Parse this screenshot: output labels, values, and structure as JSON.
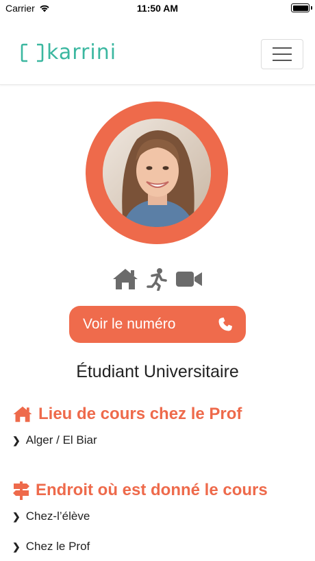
{
  "status_bar": {
    "carrier": "Carrier",
    "time": "11:50 AM",
    "wifi_icon": "wifi-icon",
    "battery_icon": "battery-icon"
  },
  "navbar": {
    "logo_text": "karrini",
    "logo_color": "#3bb7a0",
    "menu_icon": "hamburger-menu-icon"
  },
  "profile": {
    "ring_color": "#ee6a4b",
    "mode_icons": [
      "home-icon",
      "running-person-icon",
      "video-camera-icon"
    ],
    "phone_button_label": "Voir le numéro",
    "phone_icon": "phone-icon",
    "subtitle": "Étudiant Universitaire"
  },
  "sections": [
    {
      "icon": "home-icon",
      "title": "Lieu de cours chez le Prof",
      "items": [
        "Alger / El Biar"
      ]
    },
    {
      "icon": "signpost-icon",
      "title": "Endroit où est donné le cours",
      "items": [
        "Chez-l’élève",
        "Chez le Prof"
      ]
    }
  ],
  "colors": {
    "accent": "#ee6a4b",
    "brand": "#3bb7a0",
    "icon_gray": "#6b6b6b"
  }
}
